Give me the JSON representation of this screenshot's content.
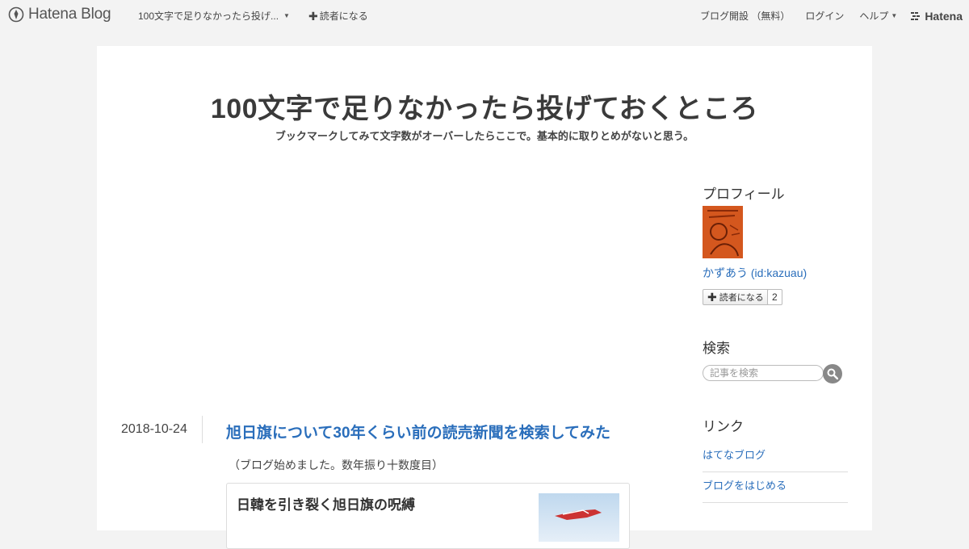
{
  "global_header": {
    "logo_text": "Hatena Blog",
    "blog_name": "100文字で足りなかったら投げ...",
    "subscribe_label": "読者になる",
    "open_blog_label": "ブログ開設 （無料）",
    "login_label": "ログイン",
    "help_label": "ヘルプ",
    "hatena_label": "Hatena"
  },
  "blog": {
    "title": "100文字で足りなかったら投げておくところ",
    "description": "ブックマークしてみて文字数がオーバーしたらここで。基本的に取りとめがないと思う。"
  },
  "entry": {
    "date": "2018-10-24",
    "title": "旭日旗について30年くらい前の読売新聞を検索してみた",
    "intro": "（ブログ始めました。数年振り十数度目）",
    "embed_title": "日韓を引き裂く旭日旗の呪縛"
  },
  "sidebar": {
    "profile": {
      "title": "プロフィール",
      "name": "かずあう (id:kazuau)",
      "subscribe_label": "読者になる",
      "subscriber_count": "2"
    },
    "search": {
      "title": "検索",
      "placeholder": "記事を検索"
    },
    "links": {
      "title": "リンク",
      "items": [
        {
          "label": "はてなブログ"
        },
        {
          "label": "ブログをはじめる"
        }
      ]
    }
  },
  "colors": {
    "page_bg": "#f3f3f3",
    "container_bg": "#ffffff",
    "link": "#2a6ebb",
    "avatar": "#d4571e"
  }
}
